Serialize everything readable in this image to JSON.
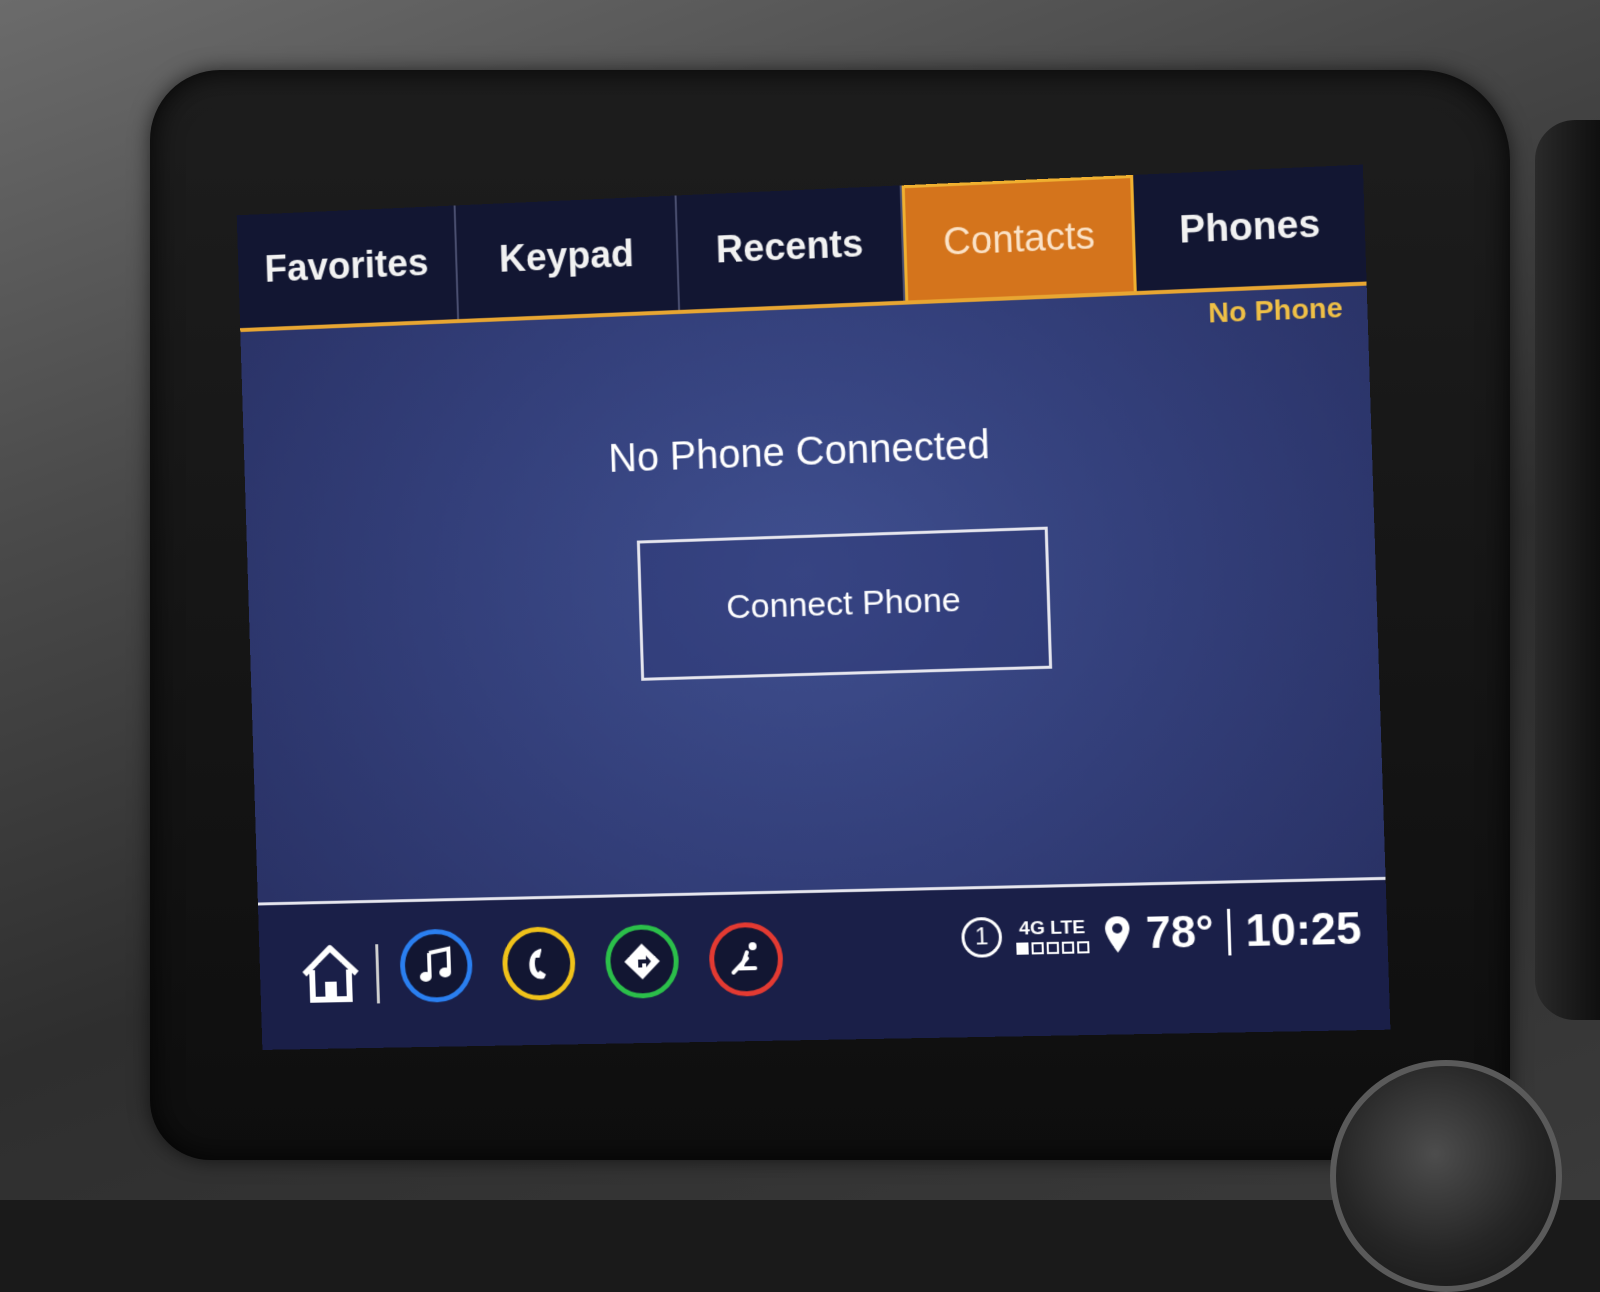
{
  "tabs": [
    {
      "label": "Favorites",
      "active": false
    },
    {
      "label": "Keypad",
      "active": false
    },
    {
      "label": "Recents",
      "active": false
    },
    {
      "label": "Contacts",
      "active": true
    },
    {
      "label": "Phones",
      "active": false
    }
  ],
  "status_label": "No Phone",
  "main": {
    "message": "No Phone Connected",
    "connect_button_label": "Connect Phone"
  },
  "bottom_bar": {
    "apps": [
      {
        "name": "music-icon",
        "color": "#2a7ff0"
      },
      {
        "name": "phone-icon",
        "color": "#f0c21a"
      },
      {
        "name": "navigation-icon",
        "color": "#2bbf4a"
      },
      {
        "name": "climate-seat-icon",
        "color": "#e33a32"
      }
    ],
    "notification_count": "1",
    "network_label": "4G LTE",
    "signal_bars_filled": 1,
    "signal_bars_total": 5,
    "temperature": "78°",
    "time": "10:25"
  },
  "colors": {
    "accent": "#e8a632",
    "active_tab": "#d4741c",
    "screen_bg": "#333f7a"
  }
}
